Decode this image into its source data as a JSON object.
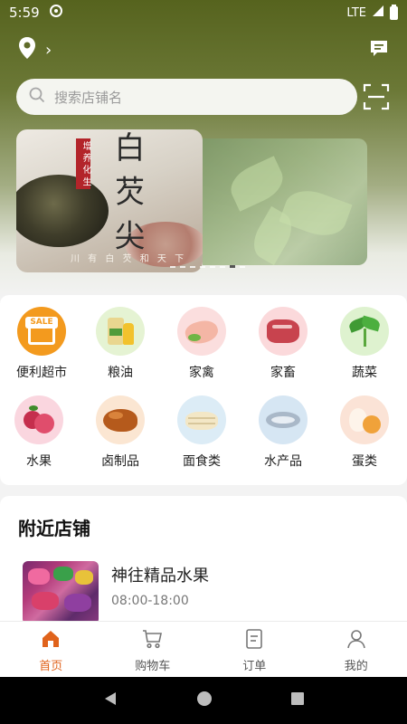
{
  "status": {
    "time": "5:59",
    "network": "LTE"
  },
  "header": {
    "location_arrow": "›"
  },
  "search": {
    "placeholder": "搜索店铺名"
  },
  "banner": {
    "seal": "增 养 化 生",
    "title": "白 芡 尖",
    "subtitle": "川 有 白 芡 和 天 下"
  },
  "categories": [
    {
      "label": "便利超市",
      "icon": "supermarket-sale-icon",
      "badge": "SALE"
    },
    {
      "label": "粮油",
      "icon": "grain-oil-icon"
    },
    {
      "label": "家禽",
      "icon": "poultry-icon"
    },
    {
      "label": "家畜",
      "icon": "livestock-meat-icon"
    },
    {
      "label": "蔬菜",
      "icon": "vegetable-icon"
    },
    {
      "label": "水果",
      "icon": "fruit-icon"
    },
    {
      "label": "卤制品",
      "icon": "braised-food-icon"
    },
    {
      "label": "面食类",
      "icon": "noodle-icon"
    },
    {
      "label": "水产品",
      "icon": "seafood-icon"
    },
    {
      "label": "蛋类",
      "icon": "egg-icon"
    }
  ],
  "nearby": {
    "heading": "附近店铺",
    "stores": [
      {
        "name": "神往精品水果",
        "hours": "08:00-18:00"
      }
    ]
  },
  "tabbar": [
    {
      "label": "首页",
      "icon": "home-icon",
      "active": true
    },
    {
      "label": "购物车",
      "icon": "cart-icon"
    },
    {
      "label": "订单",
      "icon": "order-icon"
    },
    {
      "label": "我的",
      "icon": "profile-icon"
    }
  ],
  "colors": {
    "accent": "#e0631c",
    "header_green": "#56631e"
  }
}
